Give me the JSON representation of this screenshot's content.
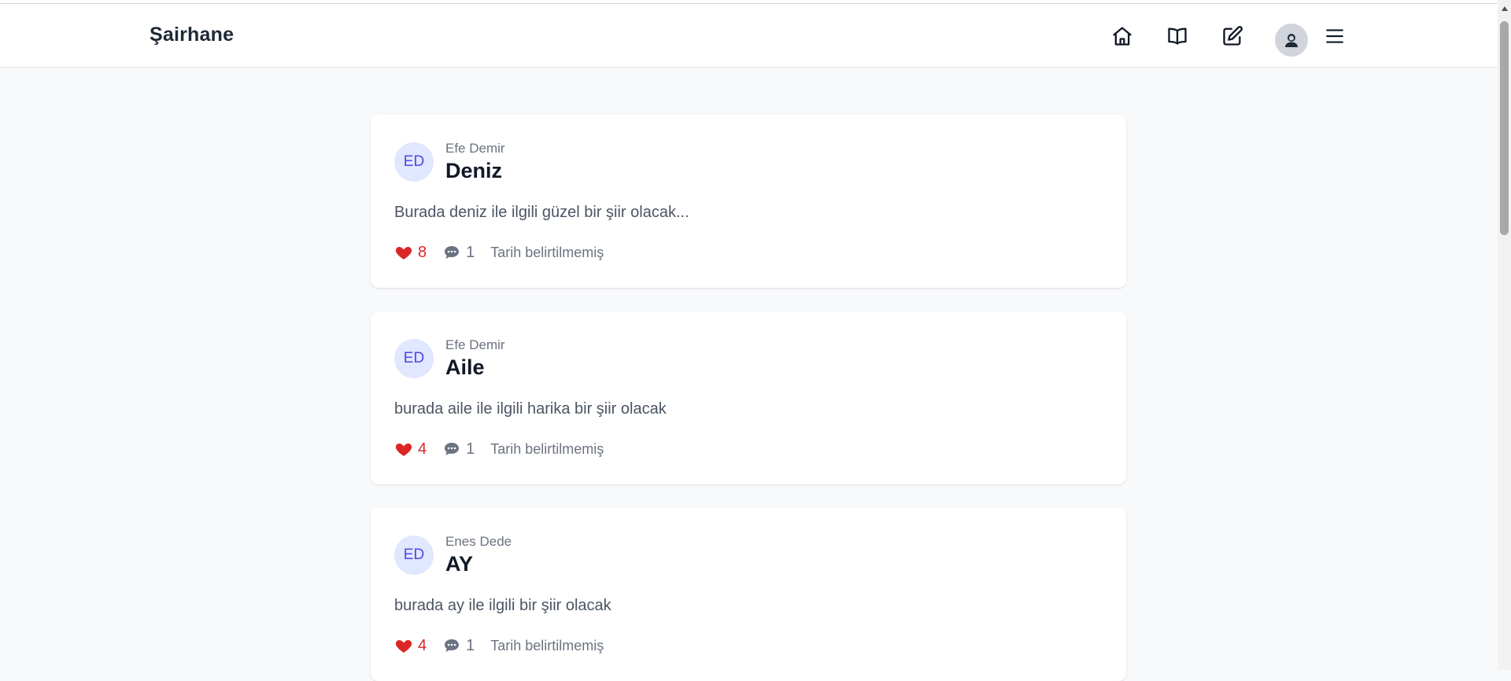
{
  "header": {
    "brand": "Şairhane",
    "nav": [
      {
        "name": "home-icon"
      },
      {
        "name": "book-icon"
      },
      {
        "name": "edit-icon"
      }
    ],
    "profile_icon": "user-avatar-icon",
    "menu_icon": "hamburger-menu-icon"
  },
  "poems": [
    {
      "initials": "ED",
      "author": "Efe Demir",
      "title": "Deniz",
      "excerpt": "Burada deniz ile ilgili güzel bir şiir olacak...",
      "likes": "8",
      "comments": "1",
      "date": "Tarih belirtilmemiş"
    },
    {
      "initials": "ED",
      "author": "Efe Demir",
      "title": "Aile",
      "excerpt": "burada aile ile ilgili harika bir şiir olacak",
      "likes": "4",
      "comments": "1",
      "date": "Tarih belirtilmemiş"
    },
    {
      "initials": "ED",
      "author": "Enes Dede",
      "title": "AY",
      "excerpt": "burada ay ile ilgili bir şiir olacak",
      "likes": "4",
      "comments": "1",
      "date": "Tarih belirtilmemiş"
    }
  ],
  "colors": {
    "like": "#dc2626",
    "avatar_bg": "#e0e7ff",
    "avatar_text": "#4f46e5",
    "page_bg": "#f8f9fb"
  }
}
